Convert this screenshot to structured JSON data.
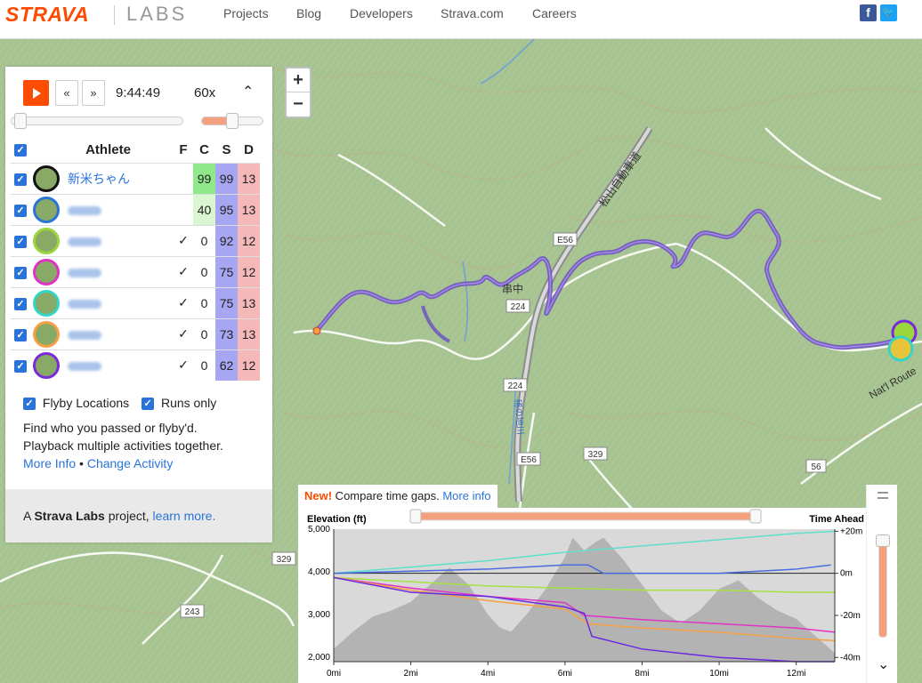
{
  "header": {
    "logo": "STRAVA",
    "labs": "LABS",
    "nav": [
      "Projects",
      "Blog",
      "Developers",
      "Strava.com",
      "Careers"
    ]
  },
  "colors": {
    "accent": "#fc4c02",
    "link": "#2a73d8",
    "route": "#7a5fc2"
  },
  "map": {
    "zoom_in": "+",
    "zoom_out": "−",
    "labels": {
      "expressway": "松山自動車道",
      "e56_a": "E56",
      "e56_b": "E56",
      "r224_a": "224",
      "r224_b": "224",
      "r329_a": "329",
      "r329_b": "329",
      "r243": "243",
      "r56": "56",
      "nat_route": "Nat'l Route",
      "town": "串中",
      "tunnel": "稀の地川"
    }
  },
  "player": {
    "play": "play-icon",
    "back": "«",
    "forward": "»",
    "time": "9:44:49",
    "speed": "60x",
    "collapse": "⌃",
    "timeline_progress": 0.02,
    "speed_level": 0.5
  },
  "table": {
    "headers": {
      "athlete": "Athlete",
      "f": "F",
      "c": "C",
      "s": "S",
      "d": "D"
    },
    "rows": [
      {
        "name": "新米ちゃん",
        "f": "",
        "c": "99",
        "s": "99",
        "d": "13",
        "ring": "#111111",
        "blur": false
      },
      {
        "name": "",
        "f": "",
        "c": "40",
        "s": "95",
        "d": "13",
        "ring": "#2a73d8",
        "blur": true
      },
      {
        "name": "",
        "f": "✓",
        "c": "0",
        "s": "92",
        "d": "12",
        "ring": "#9ad53a",
        "blur": true
      },
      {
        "name": "",
        "f": "✓",
        "c": "0",
        "s": "75",
        "d": "12",
        "ring": "#e033c6",
        "blur": true
      },
      {
        "name": "",
        "f": "✓",
        "c": "0",
        "s": "75",
        "d": "13",
        "ring": "#33d6c6",
        "blur": true
      },
      {
        "name": "",
        "f": "✓",
        "c": "0",
        "s": "73",
        "d": "13",
        "ring": "#f5a142",
        "blur": true
      },
      {
        "name": "",
        "f": "✓",
        "c": "0",
        "s": "62",
        "d": "12",
        "ring": "#7a2ad8",
        "blur": true
      }
    ]
  },
  "options": {
    "flyby": "Flyby Locations",
    "runs_only": "Runs only"
  },
  "description": {
    "line1": "Find who you passed or flyby'd.",
    "line2": "Playback multiple activities together.",
    "more_info": "More Info",
    "bullet": "•",
    "change_activity": "Change Activity"
  },
  "footer": {
    "prefix": "A ",
    "brand": "Strava Labs",
    "middle": " project, ",
    "learn_more": "learn more."
  },
  "elevation": {
    "new_label": "New!",
    "compare": " Compare time gaps. ",
    "more_info": "More info",
    "left_title": "Elevation (ft)",
    "right_title": "Time Ahead",
    "menu_icon": "menu-icon",
    "collapse": "⌄"
  },
  "chart_data": {
    "type": "line",
    "title": "",
    "xlabel": "",
    "ylabel": "Elevation (ft)",
    "y2label": "Time Ahead",
    "xlim": [
      0,
      13
    ],
    "ylim": [
      1900,
      5000
    ],
    "y2lim": [
      -42,
      21
    ],
    "x_ticks": [
      "0mi",
      "2mi",
      "4mi",
      "6mi",
      "8mi",
      "10mi",
      "12mi"
    ],
    "y_ticks": [
      "2,000",
      "3,000",
      "4,000",
      "5,000"
    ],
    "y2_ticks": [
      "+20m",
      "0m",
      "-20m",
      "-40m"
    ],
    "elevation_profile": {
      "x": [
        0,
        0.5,
        1,
        1.5,
        2,
        2.5,
        3,
        3.5,
        4,
        4.3,
        4.6,
        5,
        5.5,
        6,
        6.2,
        6.5,
        6.8,
        7,
        7.5,
        8,
        8.5,
        9,
        9.5,
        10,
        10.5,
        11,
        11.5,
        12,
        12.5,
        13
      ],
      "y": [
        2200,
        2600,
        2950,
        3100,
        3300,
        3700,
        4100,
        3700,
        3000,
        2700,
        2600,
        3000,
        3600,
        4350,
        4800,
        4500,
        4700,
        4800,
        4300,
        3700,
        3100,
        2800,
        3100,
        3600,
        3800,
        3400,
        3100,
        2900,
        2500,
        2100
      ]
    },
    "series": [
      {
        "x": [
          0,
          2,
          4,
          6,
          8,
          10,
          12,
          13
        ],
        "y": [
          0,
          3,
          6,
          10,
          13,
          16,
          19,
          20
        ],
        "color": "#5fe0cf"
      },
      {
        "x": [
          0,
          2,
          4,
          6,
          6.6,
          7,
          8,
          10,
          12,
          12.9
        ],
        "y": [
          0,
          1,
          2,
          4,
          4,
          0,
          0,
          0,
          2,
          4
        ],
        "color": "#4a6be0"
      },
      {
        "x": [
          0,
          2,
          4,
          6,
          8,
          10,
          12,
          13
        ],
        "y": [
          -2,
          -4,
          -6,
          -7,
          -8,
          -8,
          -9,
          -9
        ],
        "color": "#a6e043"
      },
      {
        "x": [
          0,
          2,
          4,
          6,
          6.5,
          8,
          10,
          12,
          13
        ],
        "y": [
          -2,
          -7,
          -11,
          -14,
          -20,
          -22,
          -24,
          -26,
          -28
        ],
        "color": "#e033c6"
      },
      {
        "x": [
          0,
          2,
          4,
          6,
          6.6,
          8,
          10,
          12,
          13
        ],
        "y": [
          -2,
          -8,
          -13,
          -17,
          -24,
          -26,
          -28,
          -31,
          -32
        ],
        "color": "#f5a142"
      },
      {
        "x": [
          0,
          2,
          4,
          6,
          6.5,
          6.7,
          8,
          10,
          12,
          13
        ],
        "y": [
          -2,
          -9,
          -11,
          -16,
          -19,
          -30,
          -36,
          -40,
          -42,
          -42
        ],
        "color": "#6a2ae0"
      }
    ]
  }
}
